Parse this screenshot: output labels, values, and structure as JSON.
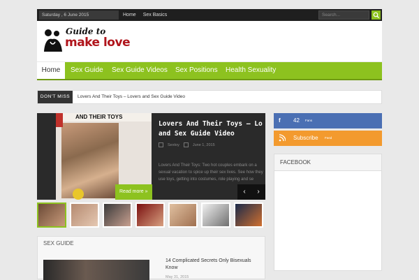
{
  "topbar": {
    "date": "Saturday , 6 June 2015",
    "nav": [
      "Home",
      "Sex Basics"
    ],
    "search_placeholder": "Search..."
  },
  "logo": {
    "line1": "Guide to",
    "line2": "make love"
  },
  "mainnav": {
    "items": [
      "Home",
      "Sex Guide",
      "Sex Guide Videos",
      "Sex Positions",
      "Health Sexuality"
    ]
  },
  "ticker": {
    "label": "DON'T MISS",
    "headline": "Lovers And Their Toys – Lovers and Sex Guide Video"
  },
  "slider": {
    "image_caption": "AND THEIR TOYS",
    "title_line1": "Lovers And Their Toys – Lo",
    "title_line2": "and Sex Guide Video",
    "author": "Sextoy",
    "date": "June 1, 2015",
    "excerpt": "Lovers And Their Toys: Two hot couples embark on a sexual vacation to spice up their sex lives. See how they use toys, getting into costumes, role playing and se",
    "read_more": "Read more »",
    "prev": "‹",
    "next": "›"
  },
  "section": {
    "title": "SEX GUIDE",
    "article_title": "14 Complicated Secrets Only Bisexuals Know",
    "article_date": "May 31, 2015"
  },
  "social": {
    "facebook": {
      "count": "42",
      "label": "Fans"
    },
    "rss": {
      "label": "Subscribe",
      "sub": "Feed"
    }
  },
  "facebook_box": {
    "title": "FACEBOOK"
  }
}
